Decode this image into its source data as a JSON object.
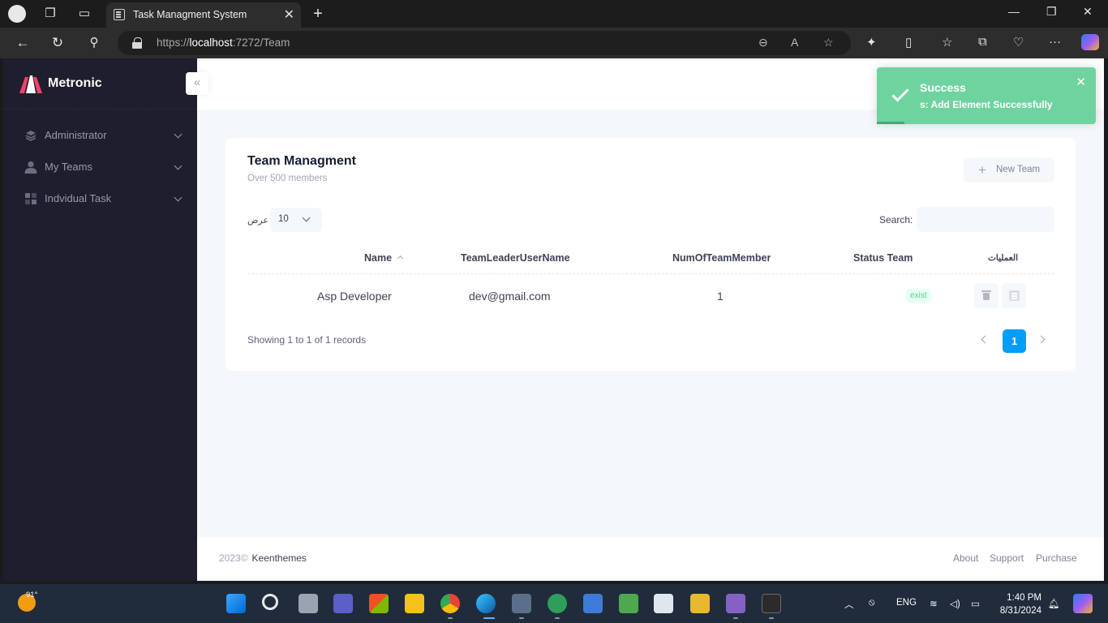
{
  "browser": {
    "tab_title": "Task Managment System",
    "url_prefix": "https://",
    "url_host": "localhost",
    "url_rest": ":7272/Team"
  },
  "sidebar": {
    "brand": "Metronic",
    "items": [
      {
        "label": "Administrator",
        "icon": "layers-icon"
      },
      {
        "label": "My Teams",
        "icon": "user-icon"
      },
      {
        "label": "Indvidual Task",
        "icon": "grid-icon"
      }
    ]
  },
  "card": {
    "title": "Team Managment",
    "subtitle": "Over 500 members",
    "new_button": "New Team",
    "length_label": "عرض",
    "length_value": "10",
    "search_label": "Search:",
    "search_value": "",
    "columns": {
      "name": "Name",
      "leader": "TeamLeaderUserName",
      "members": "NumOfTeamMember",
      "status": "Status Team",
      "actions": "العمليات"
    },
    "rows": [
      {
        "name": "Asp Developer",
        "leader": "dev@gmail.com",
        "members": "1",
        "status": "exist"
      }
    ],
    "info": "Showing 1 to 1 of 1 records",
    "current_page": "1"
  },
  "footer": {
    "year": "2023©",
    "company": "Keenthemes",
    "links": [
      "About",
      "Support",
      "Purchase"
    ]
  },
  "toast": {
    "title": "Success",
    "message": "s: Add Element Successfully",
    "color": "#6fd3a0"
  },
  "taskbar": {
    "temperature": "91°",
    "language": "ENG",
    "time": "1:40 PM",
    "date": "8/31/2024"
  },
  "colors": {
    "sidebar_bg": "#1e1e2d",
    "primary": "#009ef7",
    "success_badge": "#50cd89",
    "page_bg": "#f5f8fa"
  }
}
